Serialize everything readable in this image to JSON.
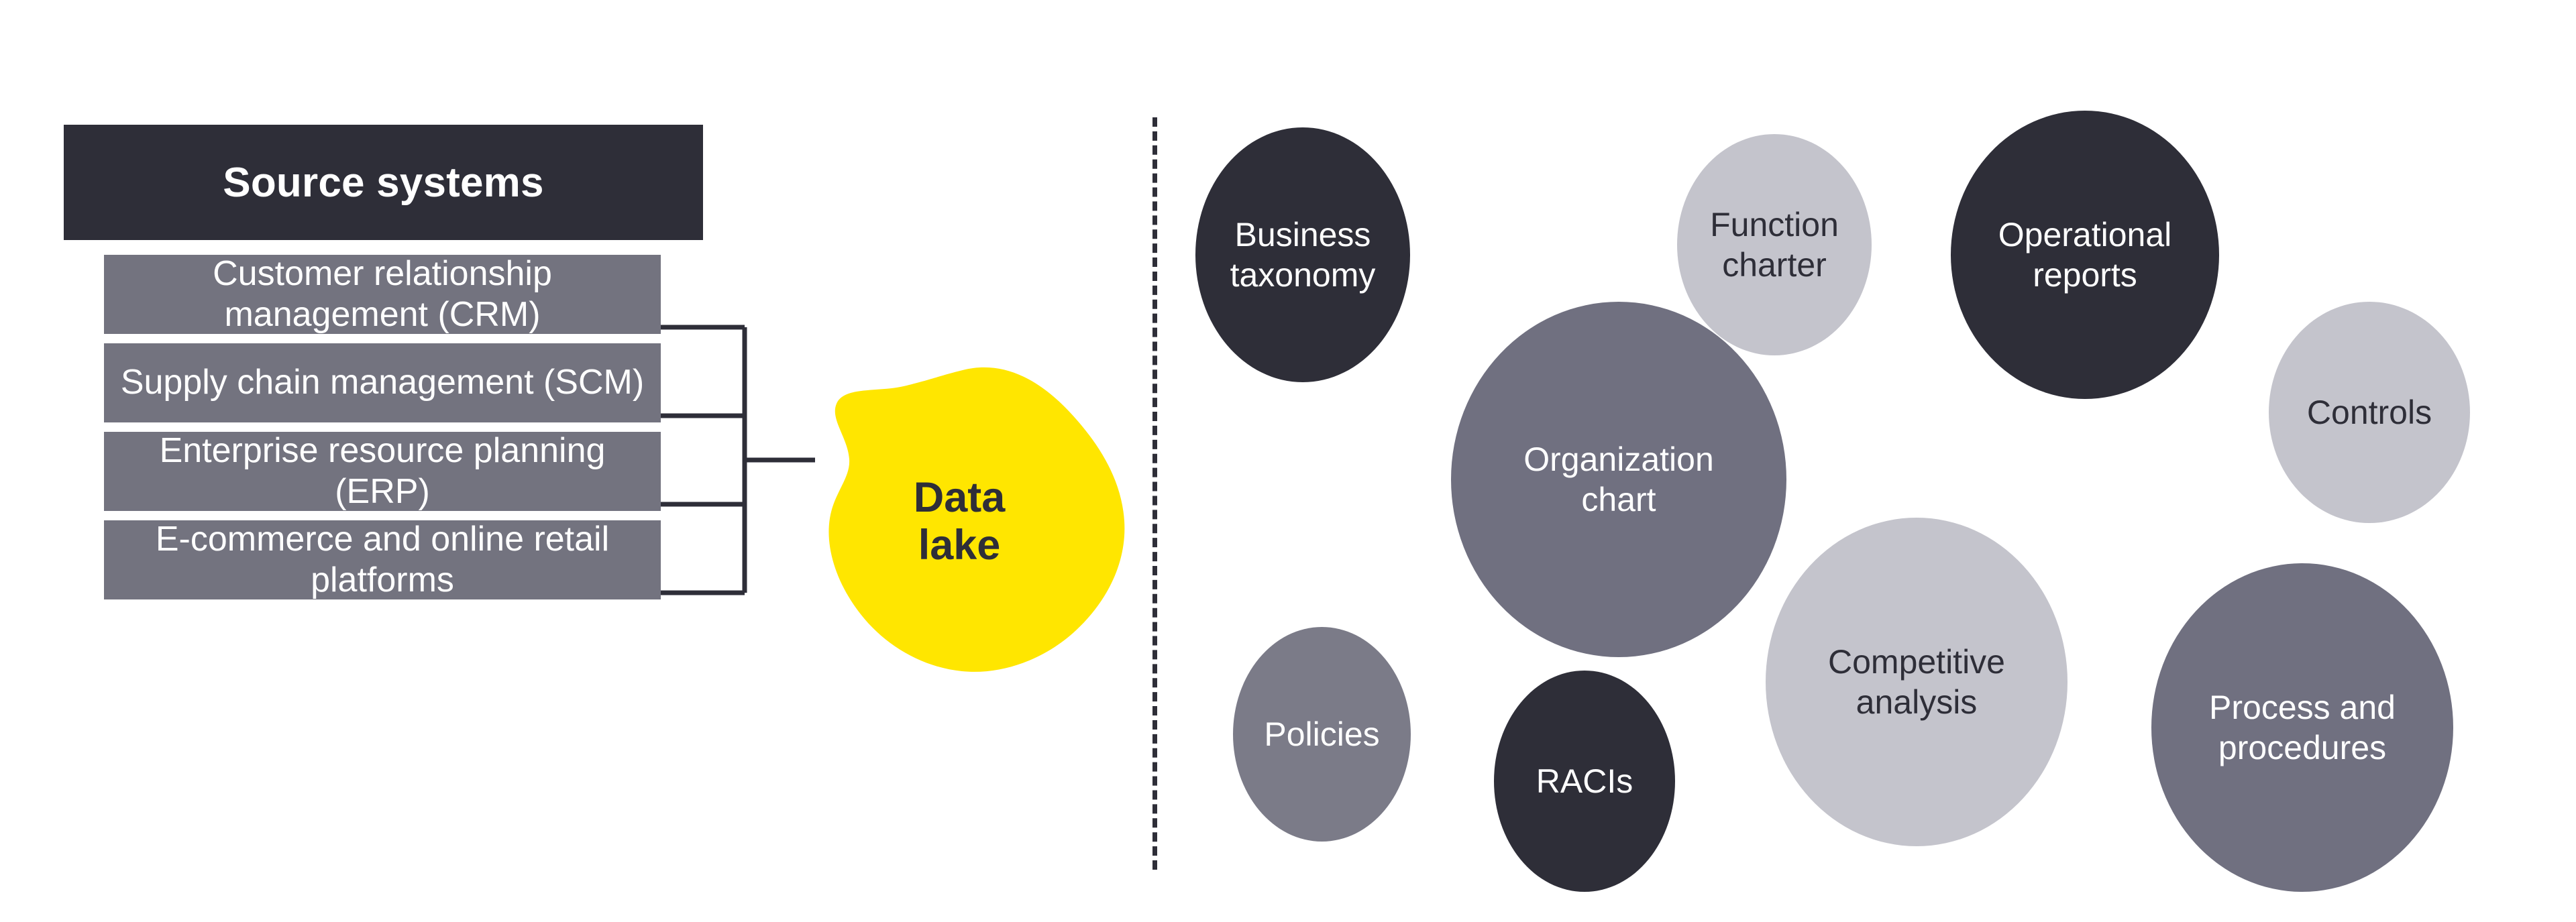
{
  "colors": {
    "dark": "#2E2E38",
    "mid_gray": "#73737F",
    "circle_mid": "#707080",
    "circle_light": "#C4C4CC",
    "accent_yellow": "#FFE600",
    "white": "#FFFFFF",
    "background": "#FFFFFF"
  },
  "left_panel": {
    "header": "Source systems",
    "systems": [
      {
        "label": "Customer relationship\nmanagement (CRM)"
      },
      {
        "label": "Supply chain\nmanagement (SCM)"
      },
      {
        "label": "Enterprise resource\nplanning (ERP)"
      },
      {
        "label": "E-commerce and online\nretail platforms"
      }
    ]
  },
  "data_lake": {
    "line1": "Data",
    "line2": "lake"
  },
  "divider": {
    "style": "dashed-vertical"
  },
  "right_panel": {
    "bubbles": [
      {
        "label": "Business\ntaxonomy",
        "fill": "#2E2E38",
        "text": "#FFFFFF"
      },
      {
        "label": "Function\ncharter",
        "fill": "#C4C4CC",
        "text": "#2E2E38"
      },
      {
        "label": "Operational\nreports",
        "fill": "#2E2E38",
        "text": "#FFFFFF"
      },
      {
        "label": "Controls",
        "fill": "#C4C4CC",
        "text": "#2E2E38"
      },
      {
        "label": "Organization\nchart",
        "fill": "#707080",
        "text": "#FFFFFF"
      },
      {
        "label": "Competitive\nanalysis",
        "fill": "#C4C4CC",
        "text": "#2E2E38"
      },
      {
        "label": "Process and\nprocedures",
        "fill": "#707080",
        "text": "#FFFFFF"
      },
      {
        "label": "Policies",
        "fill": "#7B7B88",
        "text": "#FFFFFF"
      },
      {
        "label": "RACIs",
        "fill": "#2E2E38",
        "text": "#FFFFFF"
      }
    ]
  }
}
